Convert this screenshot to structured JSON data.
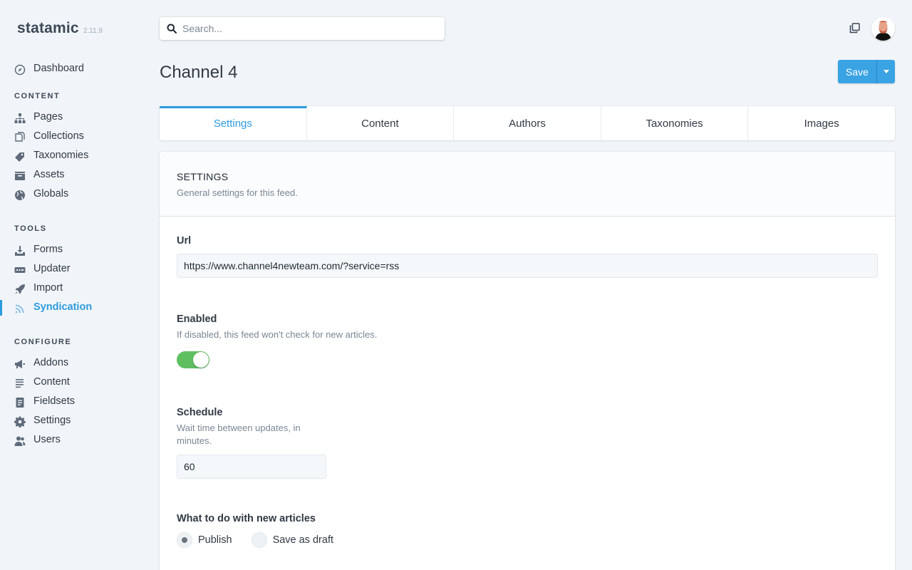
{
  "app": {
    "name": "statamic",
    "version": "2.11.9"
  },
  "sidebar": {
    "items_top": [
      {
        "label": "Dashboard",
        "icon": "compass-icon"
      }
    ],
    "sections": [
      {
        "title": "CONTENT",
        "items": [
          {
            "label": "Pages",
            "icon": "sitemap-icon"
          },
          {
            "label": "Collections",
            "icon": "collections-icon"
          },
          {
            "label": "Taxonomies",
            "icon": "tag-icon"
          },
          {
            "label": "Assets",
            "icon": "assets-icon"
          },
          {
            "label": "Globals",
            "icon": "globe-icon"
          }
        ]
      },
      {
        "title": "TOOLS",
        "items": [
          {
            "label": "Forms",
            "icon": "download-tray-icon"
          },
          {
            "label": "Updater",
            "icon": "updater-icon"
          },
          {
            "label": "Import",
            "icon": "rocket-icon"
          },
          {
            "label": "Syndication",
            "icon": "rss-icon",
            "active": true
          }
        ]
      },
      {
        "title": "CONFIGURE",
        "items": [
          {
            "label": "Addons",
            "icon": "megaphone-icon"
          },
          {
            "label": "Content",
            "icon": "lines-icon"
          },
          {
            "label": "Fieldsets",
            "icon": "document-icon"
          },
          {
            "label": "Settings",
            "icon": "gear-icon"
          },
          {
            "label": "Users",
            "icon": "users-icon"
          }
        ]
      }
    ]
  },
  "search": {
    "placeholder": "Search..."
  },
  "header": {
    "title": "Channel 4",
    "save_label": "Save"
  },
  "tabs": [
    {
      "label": "Settings",
      "active": true
    },
    {
      "label": "Content"
    },
    {
      "label": "Authors"
    },
    {
      "label": "Taxonomies"
    },
    {
      "label": "Images"
    }
  ],
  "settings": {
    "title": "SETTINGS",
    "description": "General settings for this feed.",
    "url": {
      "label": "Url",
      "value": "https://www.channel4newteam.com/?service=rss"
    },
    "enabled": {
      "label": "Enabled",
      "help": "If disabled, this feed won't check for new articles.",
      "value": true
    },
    "schedule": {
      "label": "Schedule",
      "help_line1": "Wait time between updates, in",
      "help_line2": "minutes.",
      "value": "60"
    },
    "new_articles": {
      "label": "What to do with new articles",
      "options": [
        {
          "label": "Publish",
          "checked": true
        },
        {
          "label": "Save as draft",
          "checked": false
        }
      ]
    }
  },
  "colors": {
    "accent": "#2e9bde",
    "toggle_on": "#5fbf60",
    "background": "#f1f5f9"
  }
}
